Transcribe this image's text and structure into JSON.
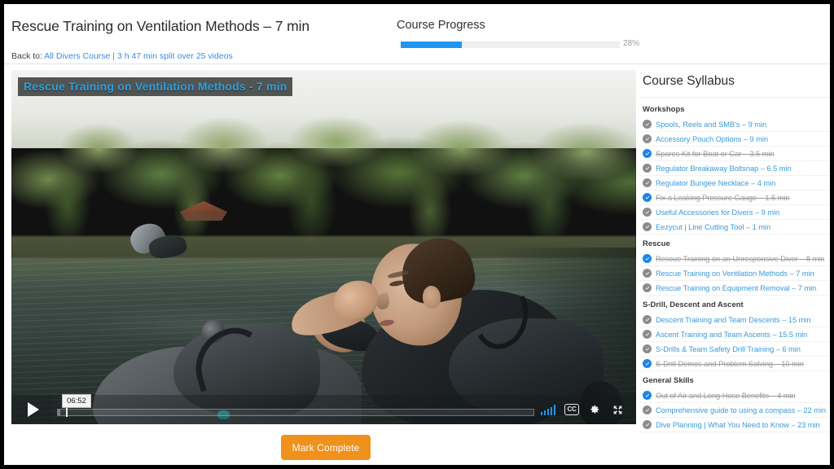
{
  "header": {
    "page_title": "Rescue Training on Ventilation Methods – 7 min",
    "back_to_label": "Back to:",
    "back_to_link": "All Divers Course | 3 h 47 min split over 25 videos",
    "progress_title": "Course Progress",
    "progress_percent_label": "28%",
    "progress_percent_value": 28,
    "progress_color": "#2196f3"
  },
  "video": {
    "title_overlay": "Rescue Training on Ventilation Methods - 7 min",
    "title_overlay_color": "#2f9fe0",
    "current_time": "06:52",
    "play_icon": "play-icon",
    "volume_icon": "volume-bars-icon",
    "cc_label": "CC",
    "settings_icon": "gear-icon",
    "fullscreen_icon": "fullscreen-icon"
  },
  "actions": {
    "mark_complete_label": "Mark Complete",
    "mark_complete_color": "#f0911e"
  },
  "syllabus": {
    "title": "Course Syllabus",
    "groups": [
      {
        "name": "Workshops",
        "items": [
          {
            "label": "Spools, Reels and SMB's – 9 min",
            "completed": false
          },
          {
            "label": "Accessory Pouch Options – 9 min",
            "completed": false
          },
          {
            "label": "Spares Kit for Boat or Car – 3.5 min",
            "completed": true
          },
          {
            "label": "Regulator Breakaway Boltsnap – 6.5 min",
            "completed": false
          },
          {
            "label": "Regulator Bungee Necklace – 4 min",
            "completed": false
          },
          {
            "label": "Fix a Leaking Pressure Gauge – 1.5 min",
            "completed": true
          },
          {
            "label": "Useful Accessories for Divers – 9 min",
            "completed": false
          },
          {
            "label": "Eezycut | Line Cutting Tool – 1 min",
            "completed": false
          }
        ]
      },
      {
        "name": "Rescue",
        "items": [
          {
            "label": "Rescue Training on an Unresponsive Diver – 8 min",
            "completed": true
          },
          {
            "label": "Rescue Training on Ventilation Methods – 7 min",
            "completed": false
          },
          {
            "label": "Rescue Training on Equipment Removal – 7 min",
            "completed": false
          }
        ]
      },
      {
        "name": "S-Drill, Descent and Ascent",
        "items": [
          {
            "label": "Descent Training and Team Descents – 15 min",
            "completed": false
          },
          {
            "label": "Ascent Training and Team Ascents – 15.5 min",
            "completed": false
          },
          {
            "label": "S-Drills & Team Safety Drill Training – 6 min",
            "completed": false
          },
          {
            "label": "S-Drill Demos and Problem Solving – 10 min",
            "completed": true
          }
        ]
      },
      {
        "name": "General Skills",
        "items": [
          {
            "label": "Out of Air and Long Hose Benefits – 4 min",
            "completed": true
          },
          {
            "label": "Comprehensive guide to using a compass – 22 min",
            "completed": false
          },
          {
            "label": "Dive Planning | What You Need to Know – 23 min",
            "completed": false
          }
        ]
      }
    ],
    "check_incomplete_color": "#8c8c8c",
    "check_complete_color": "#1a86e8",
    "link_color": "#3a9ad9"
  }
}
